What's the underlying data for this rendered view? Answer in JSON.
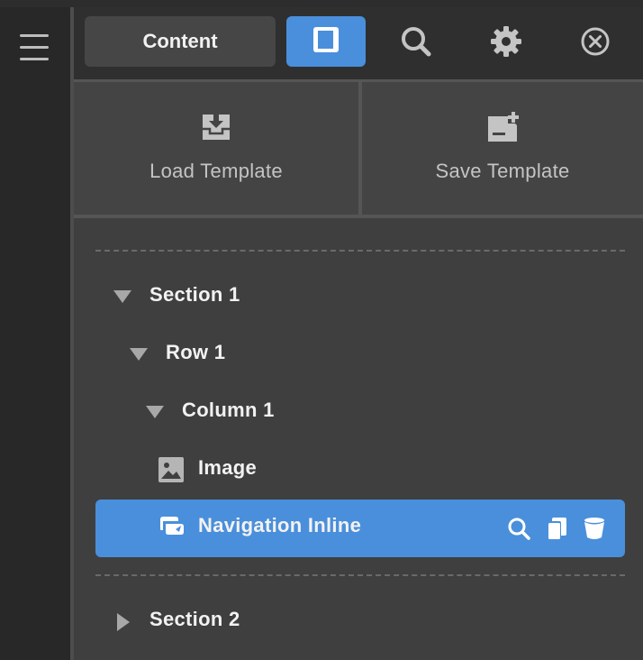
{
  "header": {
    "content_tab": "Content"
  },
  "templates": {
    "load_label": "Load Template",
    "save_label": "Save Template"
  },
  "tree": {
    "section1": "Section 1",
    "row1": "Row 1",
    "column1": "Column 1",
    "image": "Image",
    "navigation_inline": "Navigation Inline",
    "section2": "Section 2"
  },
  "colors": {
    "accent": "#4a8fdb",
    "panel": "#3f3f3f",
    "sidebar": "#282828"
  },
  "icons": {
    "menu": "hamburger-icon",
    "layout": "layout-panel-icon",
    "search": "search-icon",
    "settings": "gear-icon",
    "close": "close-circle-icon",
    "load": "download-box-icon",
    "save": "note-add-icon",
    "image": "image-icon",
    "navigation": "navigation-icon",
    "inspect": "search-icon",
    "duplicate": "duplicate-icon",
    "delete": "trash-icon"
  }
}
